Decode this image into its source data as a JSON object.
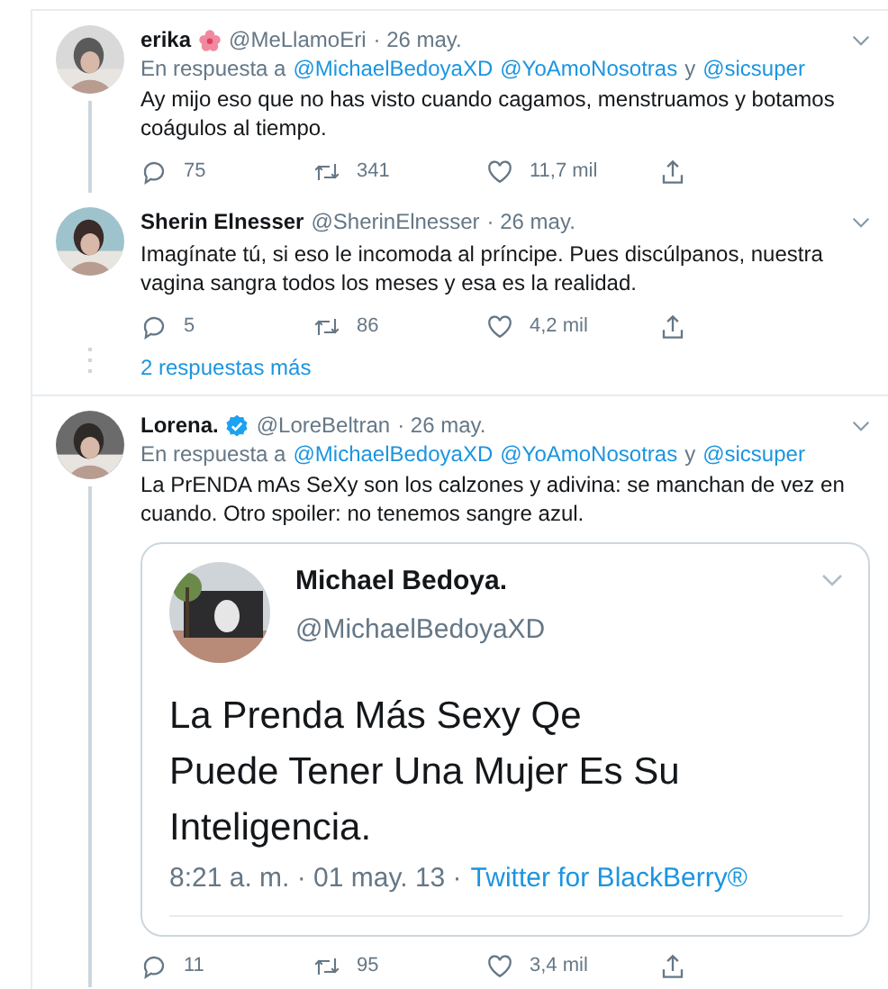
{
  "tweets": [
    {
      "name": "erika",
      "flower_badge": true,
      "verified": false,
      "handle": "@MeLlamoEri",
      "date": "· 26 may.",
      "reply_to": [
        "En respuesta a",
        "@MichaelBedoyaXD",
        "@YoAmoNosotras",
        "y",
        "@sicsuper"
      ],
      "text": "Ay mijo eso que no has visto cuando cagamos, menstruamos y botamos coágulos al tiempo.",
      "replies": "75",
      "retweets": "341",
      "likes": "11,7 mil",
      "thread_below": true
    },
    {
      "name": "Sherin Elnesser",
      "flower_badge": false,
      "verified": false,
      "handle": "@SherinElnesser",
      "date": "· 26 may.",
      "text": "Imagínate tú, si eso le incomoda al príncipe. Pues discúlpanos, nuestra vagina sangra todos los meses y esa es la realidad.",
      "replies": "5",
      "retweets": "86",
      "likes": "4,2 mil",
      "thread_below": false,
      "more_replies": "2 respuestas más"
    },
    {
      "name": "Lorena.",
      "flower_badge": false,
      "verified": true,
      "handle": "@LoreBeltran",
      "date": "· 26 may.",
      "reply_to": [
        "En respuesta a",
        "@MichaelBedoyaXD",
        "@YoAmoNosotras",
        "y",
        "@sicsuper"
      ],
      "text": "La PrENDA mAs SeXy son los calzones y adivina: se manchan de vez en cuando. Otro spoiler: no tenemos sangre azul.",
      "thread_below": true,
      "quoted": {
        "name": "Michael Bedoya.",
        "handle": "@MichaelBedoyaXD",
        "text": "La Prenda Más Sexy Qe Puede Tener Una Mujer Es Su Inteligencia.",
        "time": "8:21 a. m. · 01 may. 13 ·",
        "source": "Twitter for BlackBerry®"
      },
      "replies": "11",
      "retweets": "95",
      "likes": "3,4 mil"
    }
  ]
}
